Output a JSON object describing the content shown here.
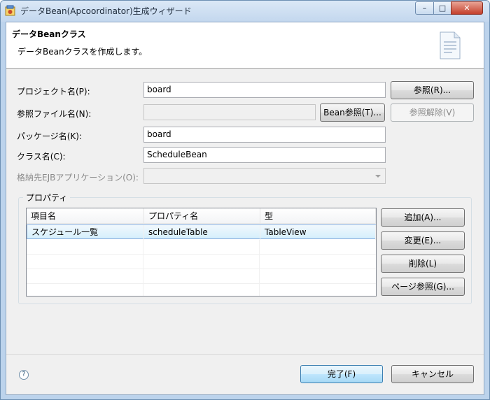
{
  "window": {
    "title": "データBean(Apcoordinator)生成ウィザード",
    "minimize_glyph": "–",
    "maximize_glyph": "□",
    "close_glyph": "✕"
  },
  "header": {
    "title": "データBeanクラス",
    "description": "データBeanクラスを作成します。"
  },
  "form": {
    "project_label": "プロジェクト名(P):",
    "project_value": "board",
    "project_browse_button": "参照(R)...",
    "ref_file_label": "参照ファイル名(N):",
    "ref_file_value": "",
    "bean_ref_button": "Bean参照(T)...",
    "ref_clear_button": "参照解除(V)",
    "package_label": "パッケージ名(K):",
    "package_value": "board",
    "class_label": "クラス名(C):",
    "class_value": "ScheduleBean",
    "ejb_label": "格納先EJBアプリケーション(O):",
    "ejb_value": ""
  },
  "properties": {
    "group_title": "プロパティ",
    "columns": [
      "項目名",
      "プロパティ名",
      "型"
    ],
    "rows": [
      [
        "スケジュール一覧",
        "scheduleTable",
        "TableView"
      ]
    ],
    "add_button": "追加(A)...",
    "edit_button": "変更(E)...",
    "delete_button": "削除(L)",
    "page_ref_button": "ページ参照(G)..."
  },
  "footer": {
    "help_glyph": "?",
    "finish_button": "完了(F)",
    "cancel_button": "キャンセル"
  }
}
